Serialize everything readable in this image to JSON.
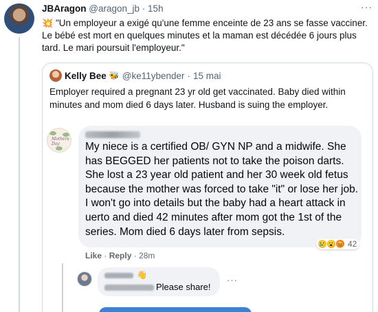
{
  "tweet": {
    "author": "JBAragon",
    "handle": "@aragon_jb",
    "separator": " · ",
    "time": "15h",
    "more": "···",
    "spark_icon": "💥",
    "text": " \"Un employeur a exigé qu'une femme enceinte de 23 ans se fasse vacciner. Le bébé est mort en quelques minutes et la maman est décédée 6 jours plus tard. Le mari poursuit l'employeur.\""
  },
  "quote": {
    "author": "Kelly Bee",
    "badge_icon": "🐝",
    "handle": "@ke11ybender",
    "separator": " · ",
    "time": "15 mai",
    "text": "Employer required a pregnant 23 yr old get vaccinated. Baby died within minutes and mom died 6 days later. Husband is suing the employer."
  },
  "fb_comment": {
    "avatar_text": "Mothers Day",
    "text": "My niece is a certified OB/ GYN NP and a midwife. She has BEGGED her patients not to take the poison darts. She lost a 23 year old patient and her 30 week old fetus because the mother was forced to take \"it\" or lose her job. I won't go into details but the baby had a heart attack in uerto and died 42 minutes after mom got the 1st of the series. Mom died 6 days later from sepsis.",
    "reaction_count": "42",
    "like_label": "Like",
    "dot": " · ",
    "reply_label": "Reply",
    "time": "28m"
  },
  "fb_reply": {
    "wave_icon": "👋",
    "text": "Please share!",
    "more": "···"
  },
  "colors": {
    "link_blue": "#1d9bf0",
    "border": "#cfd9de",
    "fb_bubble": "#f0f2f5",
    "fb_button": "#3b82d4"
  }
}
